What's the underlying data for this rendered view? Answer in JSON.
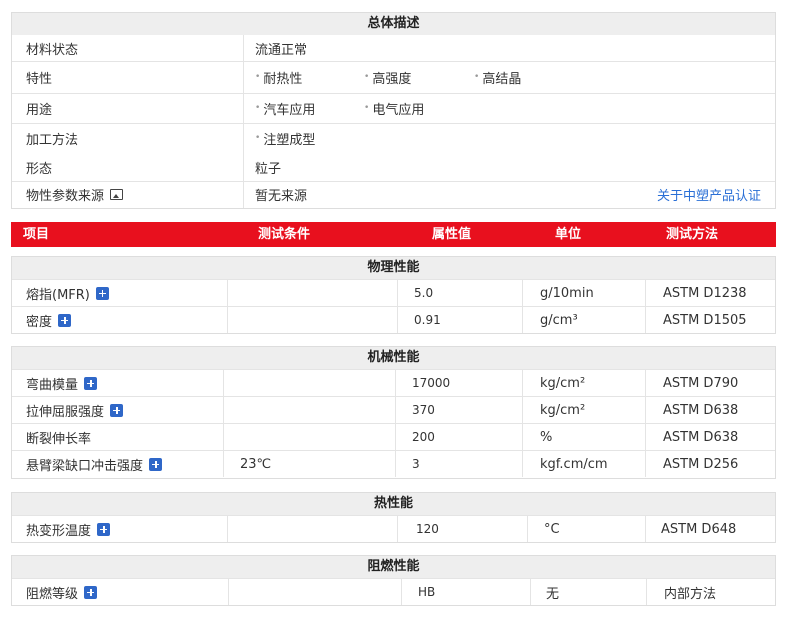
{
  "overview": {
    "title": "总体描述",
    "rows": [
      {
        "label": "材料状态",
        "value": "流通正常"
      },
      {
        "label": "特性",
        "tags": [
          "耐热性",
          "高强度",
          "高结晶"
        ]
      },
      {
        "label": "用途",
        "tags": [
          "汽车应用",
          "电气应用"
        ]
      },
      {
        "label": "加工方法",
        "tags": [
          "注塑成型"
        ]
      },
      {
        "label": "形态",
        "value": "粒子"
      },
      {
        "label": "物性参数来源",
        "value": "暂无来源",
        "link": "关于中塑产品认证"
      }
    ]
  },
  "columns": [
    "项目",
    "测试条件",
    "属性值",
    "单位",
    "测试方法"
  ],
  "sections": [
    {
      "title": "物理性能",
      "rows": [
        {
          "name": "熔指(MFR)",
          "condition": "",
          "value": "5.0",
          "unit": "g/10min",
          "method": "ASTM D1238"
        },
        {
          "name": "密度",
          "condition": "",
          "value": "0.91",
          "unit": "g/cm³",
          "method": "ASTM D1505"
        }
      ]
    },
    {
      "title": "机械性能",
      "rows": [
        {
          "name": "弯曲模量",
          "condition": "",
          "value": "17000",
          "unit": "kg/cm²",
          "method": "ASTM D790"
        },
        {
          "name": "拉伸屈服强度",
          "condition": "",
          "value": "370",
          "unit": "kg/cm²",
          "method": "ASTM D638"
        },
        {
          "name": "断裂伸长率",
          "condition": "",
          "value": "200",
          "unit": "%",
          "method": "ASTM D638"
        },
        {
          "name": "悬臂梁缺口冲击强度",
          "condition": "23℃",
          "value": "3",
          "unit": "kgf.cm/cm",
          "method": "ASTM D256"
        }
      ]
    },
    {
      "title": "热性能",
      "rows": [
        {
          "name": "热变形温度",
          "condition": "",
          "value": "120",
          "unit": "°C",
          "method": "ASTM D648"
        }
      ]
    },
    {
      "title": "阻燃性能",
      "rows": [
        {
          "name": "阻燃等级",
          "condition": "",
          "value": "HB",
          "unit": "无",
          "method": "内部方法"
        }
      ]
    }
  ]
}
